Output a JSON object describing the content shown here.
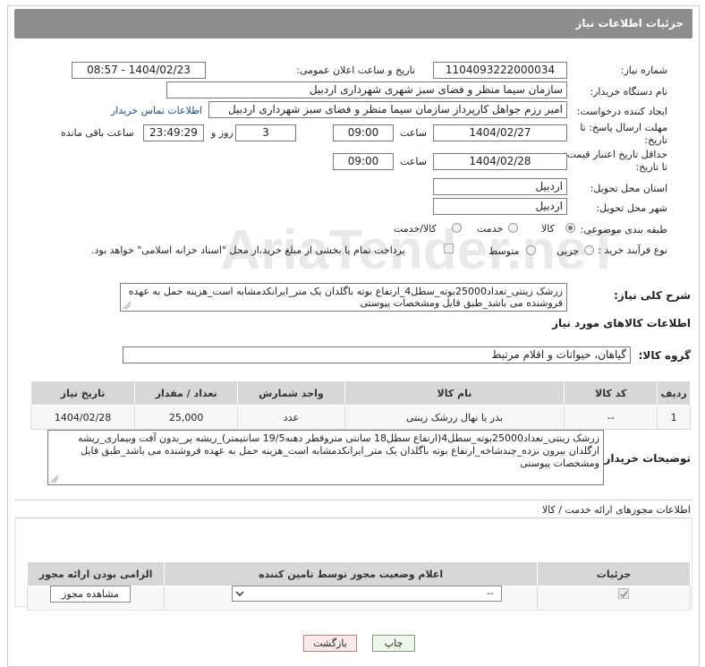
{
  "header": {
    "title": "جزئیات اطلاعات نیاز"
  },
  "form": {
    "need_number_label": "شماره نیاز:",
    "need_number": "1104093222000034",
    "announce_label": "تاریخ و ساعت اعلان عمومی:",
    "announce_value": "1404/02/23 - 08:57",
    "buyer_label": "نام دستگاه خریدار:",
    "buyer_value": "سازمان سیما منظر و فضای سبز شهری شهرداری اردبیل",
    "creator_label": "ایجاد کننده درخواست:",
    "creator_value": "امیر رزم جواهل کارپرداز سازمان سیما منظر و فضای سبز شهرداری اردبیل",
    "contact_link": "اطلاعات تماس خریدار",
    "deadline_label": "مهلت ارسال پاسخ: تا تاریخ:",
    "deadline_date": "1404/02/27",
    "time_label": "ساعت",
    "deadline_time": "09:00",
    "days_value": "3",
    "days_label": "روز و",
    "remaining_value": "23:49:29",
    "remaining_label": "ساعت باقی مانده",
    "validity_label": "حداقل تاریخ اعتبار قیمت: تا تاریخ:",
    "validity_date": "1404/02/28",
    "validity_time": "09:00",
    "province_label": "استان محل تحویل:",
    "province_value": "اردبیل",
    "city_label": "شهر محل تحویل:",
    "city_value": "اردبیل",
    "category_label": "طبقه بندی موضوعی:",
    "category_options": [
      "کالا",
      "خدمت",
      "کالا/خدمت"
    ],
    "category_selected": "کالا",
    "process_label": "نوع فرآیند خرید :",
    "process_options": [
      "جزیی",
      "متوسط"
    ],
    "process_selected": "",
    "payment_note": "پرداخت تمام یا بخشی از مبلغ خرید،از محل \"اسناد خزانه اسلامی\" خواهد بود.",
    "summary_label": "شرح کلی نیاز:",
    "summary_value": "زرشک زینتی_تعداد25000بوته_سطل4_ارتفاع بوته باگلدان یک متر_ایرانکدمشابه است_هزینه حمل به عهده فروشنده می باشد_طبق فایل ومشخصات پیوستی"
  },
  "goods": {
    "section_title": "اطلاعات کالاهای مورد نیاز",
    "group_label": "گروه کالا:",
    "group_value": "گیاهان، حیوانات و اقلام مرتبط",
    "columns": [
      "ردیف",
      "کد کالا",
      "نام کالا",
      "واحد شمارش",
      "تعداد / مقدار",
      "تاریخ نیاز"
    ],
    "rows": [
      [
        "1",
        "--",
        "بذر یا نهال زرشک زینتی",
        "عدد",
        "25,000",
        "1404/02/28"
      ]
    ],
    "buyer_notes_label": "توضیحات خریدار:",
    "buyer_notes": "زرشک زینتی_تعداد25000بوته_سطل4(ارتفاع سطل18 سانتی متروقطر دهنه19/5 سانتیمتر)_ریشه پر_بدون آفت وبیماری_ریشه ازگلدان بیرون نزده_چندشاخه_ارتفاع بوته باگلدان یک متر_ایرانکدمشابه است_هزینه حمل به عهده فروشنده می باشد_طبق فایل ومشخصات پیوستی"
  },
  "permits": {
    "section_title": "اطلاعات مجوزهای ارائه خدمت / کالا",
    "columns": [
      "الزامی بودن ارائه مجوز",
      "اعلام وضعیت مجوز توسط تامین کننده",
      "جزئیات"
    ],
    "select_value": "--",
    "view_button": "مشاهده مجوز"
  },
  "footer": {
    "print": "چاپ",
    "back": "بازگشت"
  },
  "watermark_text": "AriaTender.neT"
}
